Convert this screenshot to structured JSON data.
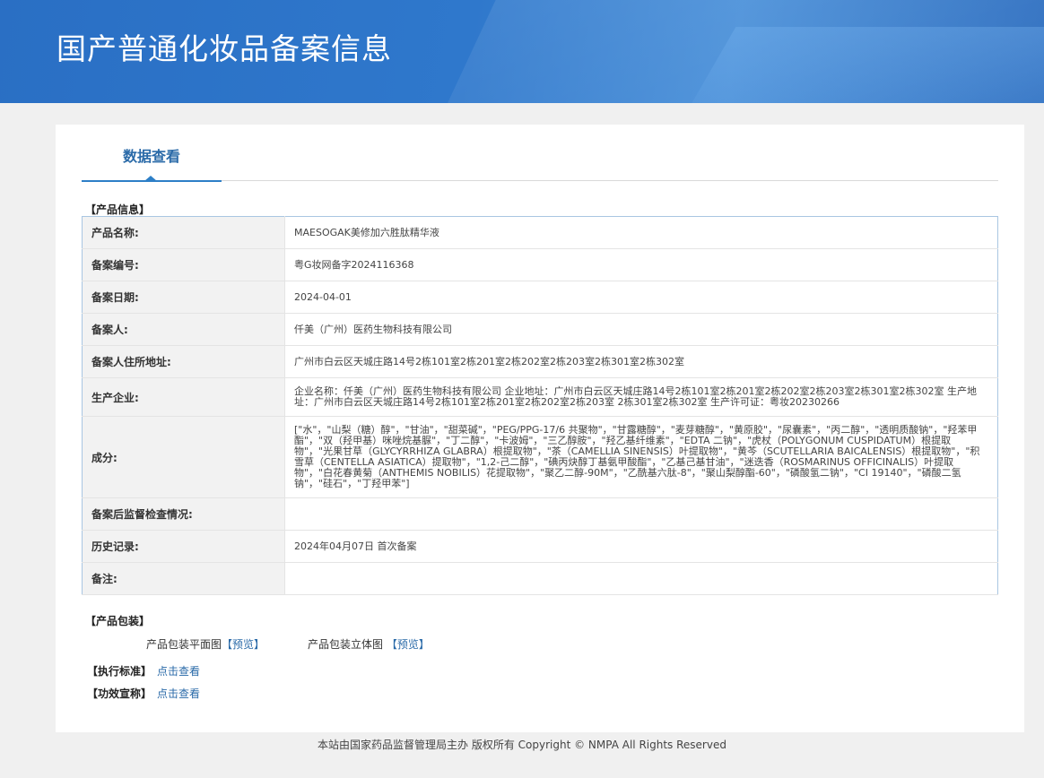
{
  "header": {
    "title": "国产普通化妆品备案信息"
  },
  "tabs": [
    {
      "label": "数据查看"
    }
  ],
  "product_info": {
    "section_title": "【产品信息】",
    "rows": [
      {
        "label": "产品名称:",
        "value": "MAESOGAK美修加六胜肽精华液"
      },
      {
        "label": "备案编号:",
        "value": "粤G妆网备字2024116368"
      },
      {
        "label": "备案日期:",
        "value": "2024-04-01"
      },
      {
        "label": "备案人:",
        "value": "仟美（广州）医药生物科技有限公司"
      },
      {
        "label": "备案人住所地址:",
        "value": "广州市白云区天城庄路14号2栋101室2栋201室2栋202室2栋203室2栋301室2栋302室"
      },
      {
        "label": "生产企业:",
        "value": "企业名称：仟美（广州）医药生物科技有限公司 企业地址：广州市白云区天城庄路14号2栋101室2栋201室2栋202室2栋203室2栋301室2栋302室 生产地址：广州市白云区天城庄路14号2栋101室2栋201室2栋202室2栋203室 2栋301室2栋302室 生产许可证：粤妆20230266"
      },
      {
        "label": "成分:",
        "value": "[\"水\"，\"山梨（糖）醇\"，\"甘油\"，\"甜菜碱\"，\"PEG/PPG-17/6 共聚物\"，\"甘露糖醇\"，\"麦芽糖醇\"，\"黄原胶\"，\"尿囊素\"，\"丙二醇\"，\"透明质酸钠\"，\"羟苯甲酯\"，\"双（羟甲基）咪唑烷基脲\"，\"丁二醇\"，\"卡波姆\"，\"三乙醇胺\"，\"羟乙基纤维素\"，\"EDTA 二钠\"，\"虎杖（POLYGONUM CUSPIDATUM）根提取物\"，\"光果甘草（GLYCYRRHIZA GLABRA）根提取物\"，\"茶（CAMELLIA SINENSIS）叶提取物\"，\"黄芩（SCUTELLARIA BAICALENSIS）根提取物\"，\"积雪草（CENTELLA ASIATICA）提取物\"，\"1,2-己二醇\"，\"碘丙炔醇丁基氨甲酸酯\"，\"乙基己基甘油\"，\"迷迭香（ROSMARINUS OFFICINALIS）叶提取物\"，\"白花春黄菊（ANTHEMIS NOBILIS）花提取物\"，\"聚乙二醇-90M\"，\"乙酰基六肽-8\"，\"聚山梨醇酯-60\"，\"磷酸氢二钠\"，\"CI 19140\"，\"磷酸二氢钠\"，\"硅石\"，\"丁羟甲苯\"]"
      },
      {
        "label": "备案后监督检查情况:",
        "value": ""
      },
      {
        "label": "历史记录:",
        "value": "2024年04月07日 首次备案"
      },
      {
        "label": "备注:",
        "value": ""
      }
    ]
  },
  "packaging": {
    "section_title": "【产品包装】",
    "flat_label": "产品包装平面图",
    "flat_link": "【预览】",
    "solid_label": "产品包装立体图",
    "solid_link": "【预览】"
  },
  "standards": {
    "label": "【执行标准】",
    "link": "点击查看"
  },
  "efficacy": {
    "label": "【功效宣称】",
    "link": "点击查看"
  },
  "footer": {
    "text": "本站由国家药品监督管理局主办 版权所有 Copyright © NMPA All Rights Reserved"
  },
  "colors": {
    "banner": "#2f78cc",
    "accent": "#2a6aa8",
    "table_border": "#a9c6e2",
    "label_bg": "#f2f2f2"
  }
}
